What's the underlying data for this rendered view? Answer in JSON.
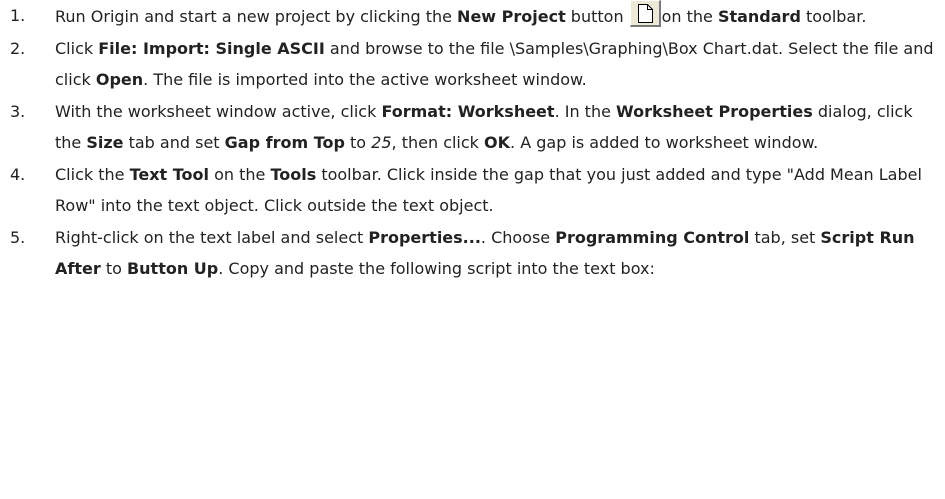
{
  "steps": [
    {
      "num": "1.",
      "t1": "Run Origin and start a new project by clicking the ",
      "b1": "New Project",
      "t2": " button",
      "icon": "new-project-icon",
      "t3": "on the ",
      "b2": "Standard",
      "t4": " toolbar."
    },
    {
      "num": "2.",
      "t1": "Click ",
      "b1": "File: Import: Single ASCII",
      "t2": " and browse to the file \\Samples\\Graphing\\Box Chart.dat. Select the file and click ",
      "b2": "Open",
      "t3": ". The file is imported into the active worksheet window."
    },
    {
      "num": "3.",
      "t1": "With the worksheet window active, click ",
      "b1": "Format: Worksheet",
      "t2": ". In the ",
      "b2": "Worksheet Properties",
      "t3": " dialog, click the ",
      "b3": "Size",
      "t4": " tab and set ",
      "b4": "Gap from Top",
      "t5": " to ",
      "i1": "25",
      "t6": ", then click ",
      "b5": "OK",
      "t7": ". A gap is added to worksheet window."
    },
    {
      "num": "4.",
      "t1": "Click the ",
      "b1": "Text Tool",
      "t2": " on the ",
      "b2": "Tools",
      "t3": " toolbar. Click inside the gap that you just added and type \"Add Mean Label Row\" into the text object. Click outside the text object."
    },
    {
      "num": "5.",
      "t1": "Right-click on the text label and select ",
      "b1": "Properties...",
      "t2": ". Choose ",
      "b2": "Programming Control",
      "t3": " tab, set ",
      "b3": "Script Run After",
      "t4": " to ",
      "b4": "Button Up",
      "t5": ". Copy and paste the following script into the text box:"
    }
  ]
}
